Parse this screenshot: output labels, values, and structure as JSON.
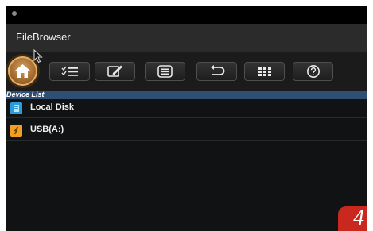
{
  "app": {
    "title": "FileBrowser"
  },
  "toolbar": {
    "home_icon": "home-icon",
    "buttons": [
      {
        "name": "select-all-button",
        "icon": "checklist-icon"
      },
      {
        "name": "edit-button",
        "icon": "edit-icon"
      },
      {
        "name": "list-view-button",
        "icon": "list-icon"
      },
      {
        "name": "back-button",
        "icon": "undo-arrow-icon"
      },
      {
        "name": "grid-view-button",
        "icon": "grid-icon"
      },
      {
        "name": "help-button",
        "icon": "help-icon"
      }
    ]
  },
  "device_list": {
    "header": "Device List",
    "items": [
      {
        "label": "Local Disk",
        "icon": "disk-icon",
        "color": "#2f9ad8"
      },
      {
        "label": "USB(A:)",
        "icon": "usb-drive-icon",
        "color": "#f0a020"
      }
    ]
  },
  "page_badge": "4",
  "colors": {
    "accent": "#e6ad63",
    "header": "#2e4f73",
    "badge": "#c8281e"
  }
}
